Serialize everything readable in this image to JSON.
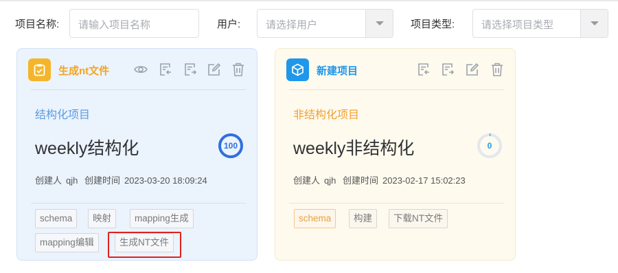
{
  "filters": {
    "name_label": "项目名称:",
    "name_placeholder": "请输入项目名称",
    "user_label": "用户:",
    "user_placeholder": "请选择用户",
    "type_label": "项目类型:",
    "type_placeholder": "请选择项目类型"
  },
  "cards": [
    {
      "title": "生成nt文件",
      "project_type": "结构化项目",
      "name": "weekly结构化",
      "progress": 100,
      "progress_label": "100",
      "creator_label": "创建人",
      "creator": "qjh",
      "created_label": "创建时间",
      "created_time": "2023-03-20 18:09:24",
      "actions": [
        "view-icon",
        "import-icon",
        "export-icon",
        "edit-icon",
        "delete-icon"
      ],
      "tags": [
        "schema",
        "映射",
        "mapping生成",
        "mapping编辑",
        "生成NT文件"
      ],
      "accent": "#f5b52b"
    },
    {
      "title": "新建项目",
      "project_type": "非结构化项目",
      "name": "weekly非结构化",
      "progress": 0,
      "progress_label": "0",
      "creator_label": "创建人",
      "creator": "qjh",
      "created_label": "创建时间",
      "created_time": "2023-02-17 15:02:23",
      "actions": [
        "import-icon",
        "export-icon",
        "edit-icon",
        "delete-icon"
      ],
      "tags": [
        "schema",
        "构建",
        "下载NT文件"
      ],
      "accent": "#1f97ea"
    }
  ]
}
